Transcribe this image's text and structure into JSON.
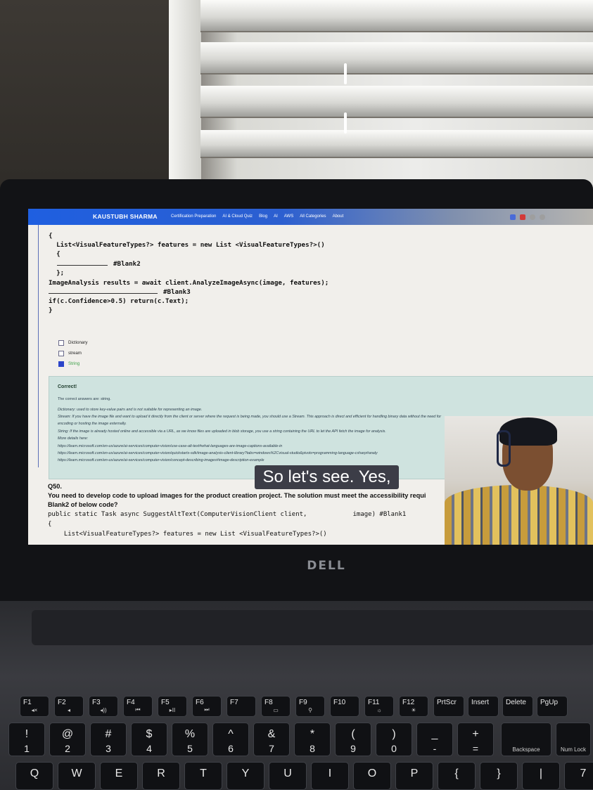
{
  "site": {
    "brand": "KAUSTUBH SHARMA",
    "nav": [
      "Certification Preparation",
      "AI & Cloud Quiz",
      "Blog",
      "AI",
      "AWS",
      "All Categories",
      "About"
    ]
  },
  "code_top": [
    "{",
    "  List<VisualFeatureTypes?> features = new List <VisualFeatureTypes?>()",
    "  {",
    "#Blank2",
    "  };",
    "ImageAnalysis results = await client.AnalyzeImageAsync(image, features);",
    "#Blank3",
    "if(c.Confidence>0.5) return(c.Text);",
    "}"
  ],
  "options": [
    {
      "label": "Dictionary",
      "checked": false
    },
    {
      "label": "stream",
      "checked": false
    },
    {
      "label": "String",
      "checked": true
    }
  ],
  "result": {
    "heading": "Correct!",
    "answer": "The correct answers are: string.",
    "lines": [
      "Dictionary: used to store key-value pairs and is not suitable for representing an image.",
      "Stream: If you have the image file and want to upload it directly from the client or server where the request is being made, you should use a Stream. This approach is direct and efficient for handling binary data without the need for",
      "encoding or hosting the image externally.",
      "String: If the image is already hosted online and accessible via a URL, as we know files are uploaded in blob storage, you use a string containing the URL to let the API fetch the image for analysis.",
      "More details here:",
      "https://learn.microsoft.com/en-us/azure/ai-services/computer-vision/use-case-alt-text#what-languages-are-image-captions-available-in",
      "https://learn.microsoft.com/en-us/azure/ai-services/computer-vision/quickstarts-sdk/image-analysis-client-library?tabs=windows%2Cvisual-studio&pivots=programming-language-csharp#analy",
      "https://learn.microsoft.com/en-us/azure/ai-services/computer-vision/concept-describing-images#image-description-example"
    ]
  },
  "question": {
    "number": "Q50.",
    "text": "You need to develop code to upload images for the product creation project. The solution must meet the accessibility requi",
    "text2": "Blank2 of below code?",
    "code": [
      "public static Task async SuggestAltText(ComputerVisionClient client,            image) #Blank1",
      "{",
      "  List<VisualFeatureTypes?> features = new List <VisualFeatureTypes?>()"
    ]
  },
  "caption": "So let's see. Yes,",
  "laptop_logo": "DELL",
  "fn_keys": [
    {
      "label": "F1",
      "icon": "◂×"
    },
    {
      "label": "F2",
      "icon": "◂"
    },
    {
      "label": "F3",
      "icon": "◂))"
    },
    {
      "label": "F4",
      "icon": "⏮"
    },
    {
      "label": "F5",
      "icon": "▸II"
    },
    {
      "label": "F6",
      "icon": "⏭"
    },
    {
      "label": "F7",
      "icon": ""
    },
    {
      "label": "F8",
      "icon": "▭"
    },
    {
      "label": "F9",
      "icon": "⚲"
    },
    {
      "label": "F10",
      "icon": ""
    },
    {
      "label": "F11",
      "icon": "☼"
    },
    {
      "label": "F12",
      "icon": "☀"
    },
    {
      "label": "PrtScr",
      "icon": ""
    },
    {
      "label": "Insert",
      "icon": ""
    },
    {
      "label": "Delete",
      "icon": ""
    },
    {
      "label": "PgUp",
      "icon": ""
    }
  ],
  "num_keys": [
    {
      "top": "!",
      "bottom": "1"
    },
    {
      "top": "@",
      "bottom": "2"
    },
    {
      "top": "#",
      "bottom": "3"
    },
    {
      "top": "$",
      "bottom": "4"
    },
    {
      "top": "%",
      "bottom": "5"
    },
    {
      "top": "^",
      "bottom": "6"
    },
    {
      "top": "&",
      "bottom": "7"
    },
    {
      "top": "*",
      "bottom": "8"
    },
    {
      "top": "(",
      "bottom": "9"
    },
    {
      "top": ")",
      "bottom": "0"
    },
    {
      "top": "_",
      "bottom": "-"
    },
    {
      "top": "+",
      "bottom": "="
    }
  ],
  "backspace": "Backspace",
  "numlock": "Num Lock",
  "letter_keys": [
    "Q",
    "W",
    "E",
    "R",
    "T",
    "Y",
    "U",
    "I",
    "O",
    "P",
    "{",
    "}",
    "|",
    "7"
  ]
}
